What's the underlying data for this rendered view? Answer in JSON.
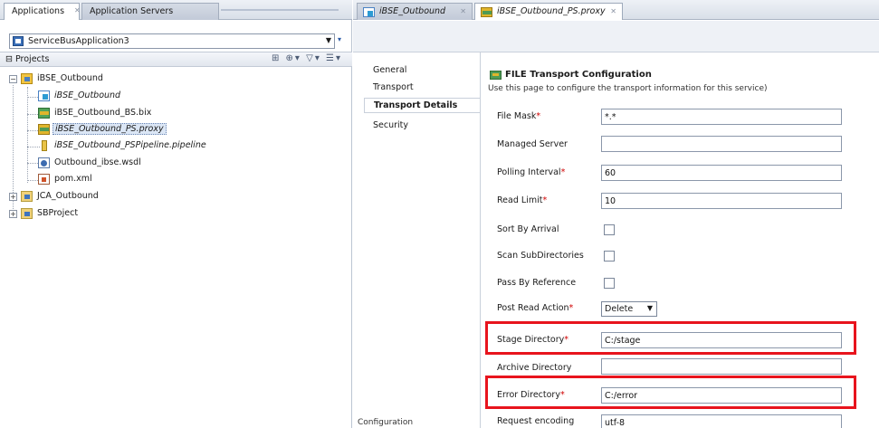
{
  "left_tabs": {
    "applications": "Applications",
    "application_servers": "Application Servers"
  },
  "app_selector": {
    "value": "ServiceBusApplication3"
  },
  "projects": {
    "title": "Projects",
    "tools": "⊞ ⊕▾ ▽▾ ☰▾"
  },
  "tree": {
    "root": "iBSE_Outbound",
    "items": [
      "iBSE_Outbound",
      "iBSE_Outbound_BS.bix",
      "iBSE_Outbound_PS.proxy",
      "iBSE_Outbound_PSPipeline.pipeline",
      "Outbound_ibse.wsdl",
      "pom.xml"
    ],
    "folders": [
      "JCA_Outbound",
      "SBProject"
    ]
  },
  "editor_tabs": [
    {
      "label": "iBSE_Outbound"
    },
    {
      "label": "iBSE_Outbound_PS.proxy"
    }
  ],
  "nav": [
    "General",
    "Transport",
    "Transport Details",
    "Security"
  ],
  "header": {
    "title": "FILE Transport Configuration",
    "description": "Use this page to configure the transport information for this service)"
  },
  "fields": {
    "file_mask": {
      "label": "File Mask",
      "value": "*.*"
    },
    "managed_server": {
      "label": "Managed Server",
      "value": ""
    },
    "polling_interval": {
      "label": "Polling Interval",
      "value": "60"
    },
    "read_limit": {
      "label": "Read Limit",
      "value": "10"
    },
    "sort_by_arrival": {
      "label": "Sort By Arrival"
    },
    "scan_subdirectories": {
      "label": "Scan SubDirectories"
    },
    "pass_by_reference": {
      "label": "Pass By Reference"
    },
    "post_read_action": {
      "label": "Post Read Action",
      "value": "Delete"
    },
    "stage_directory": {
      "label": "Stage Directory",
      "value": "C:/stage"
    },
    "archive_directory": {
      "label": "Archive Directory",
      "value": ""
    },
    "error_directory": {
      "label": "Error Directory",
      "value": "C:/error"
    },
    "request_encoding": {
      "label": "Request encoding",
      "value": "utf-8"
    }
  },
  "bottom_tab": "Configuration",
  "colors": {
    "highlight": "#e8141d",
    "required": "#d00000"
  },
  "icons": [
    "project-icon",
    "folder-icon",
    "business-service-icon",
    "proxy-service-icon",
    "pipeline-icon",
    "wsdl-icon",
    "pom-icon",
    "rpc-icon"
  ]
}
